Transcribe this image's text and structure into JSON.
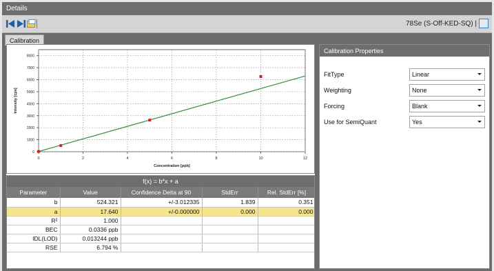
{
  "window": {
    "title": "Details"
  },
  "toolbar": {
    "right_label": "78Se (S-Off-KED-SQ) |",
    "icons": [
      "first-icon",
      "last-icon",
      "export-icon",
      "window-icon"
    ]
  },
  "tabs": [
    {
      "label": "Calibration"
    }
  ],
  "chart_data": {
    "type": "scatter",
    "title": "",
    "xlabel": "Concentration [ppb]",
    "ylabel": "Intensity [cps]",
    "xlim": [
      0,
      12
    ],
    "ylim": [
      0,
      8500
    ],
    "x_ticks": [
      0,
      2,
      4,
      6,
      8,
      10,
      12
    ],
    "y_ticks": [
      0,
      1000,
      2000,
      3000,
      4000,
      5000,
      6000,
      7000,
      8000
    ],
    "points": [
      {
        "x": 0,
        "y": 20
      },
      {
        "x": 1,
        "y": 510
      },
      {
        "x": 5,
        "y": 2630
      },
      {
        "x": 10,
        "y": 6260
      }
    ],
    "fit": {
      "slope": 524.321,
      "intercept": 17.64
    },
    "grid": true,
    "colors": {
      "points": "#e01b1b",
      "line": "#2f8f3a",
      "grid": "#9a9a9a"
    }
  },
  "formula": "f(x) = b*x + a",
  "param_table": {
    "headers": [
      "Parameter",
      "Value",
      "Confidence Delta at 90",
      "StdErr",
      "Rel. StdErr [%]"
    ],
    "rows": [
      {
        "param": "b",
        "value": "524.321",
        "conf": "+/-3.012335",
        "stderr": "1.839",
        "rel": "0.351"
      },
      {
        "param": "a",
        "value": "17.640",
        "conf": "+/-0.000000",
        "stderr": "0.000",
        "rel": "0.000"
      },
      {
        "param": "R²",
        "value": "1.000",
        "conf": "",
        "stderr": "",
        "rel": ""
      },
      {
        "param": "BEC",
        "value": "0.0336 ppb",
        "conf": "",
        "stderr": "",
        "rel": ""
      },
      {
        "param": "IDL(LOD)",
        "value": "0.013244 ppb",
        "conf": "",
        "stderr": "",
        "rel": ""
      },
      {
        "param": "RSE",
        "value": "6.794 %",
        "conf": "",
        "stderr": "",
        "rel": ""
      }
    ]
  },
  "calibration_properties": {
    "title": "Calibration Properties",
    "rows": [
      {
        "label": "FitType",
        "value": "Linear"
      },
      {
        "label": "Weighting",
        "value": "None"
      },
      {
        "label": "Forcing",
        "value": "Blank"
      },
      {
        "label": "Use for SemiQuant",
        "value": "Yes"
      }
    ]
  }
}
